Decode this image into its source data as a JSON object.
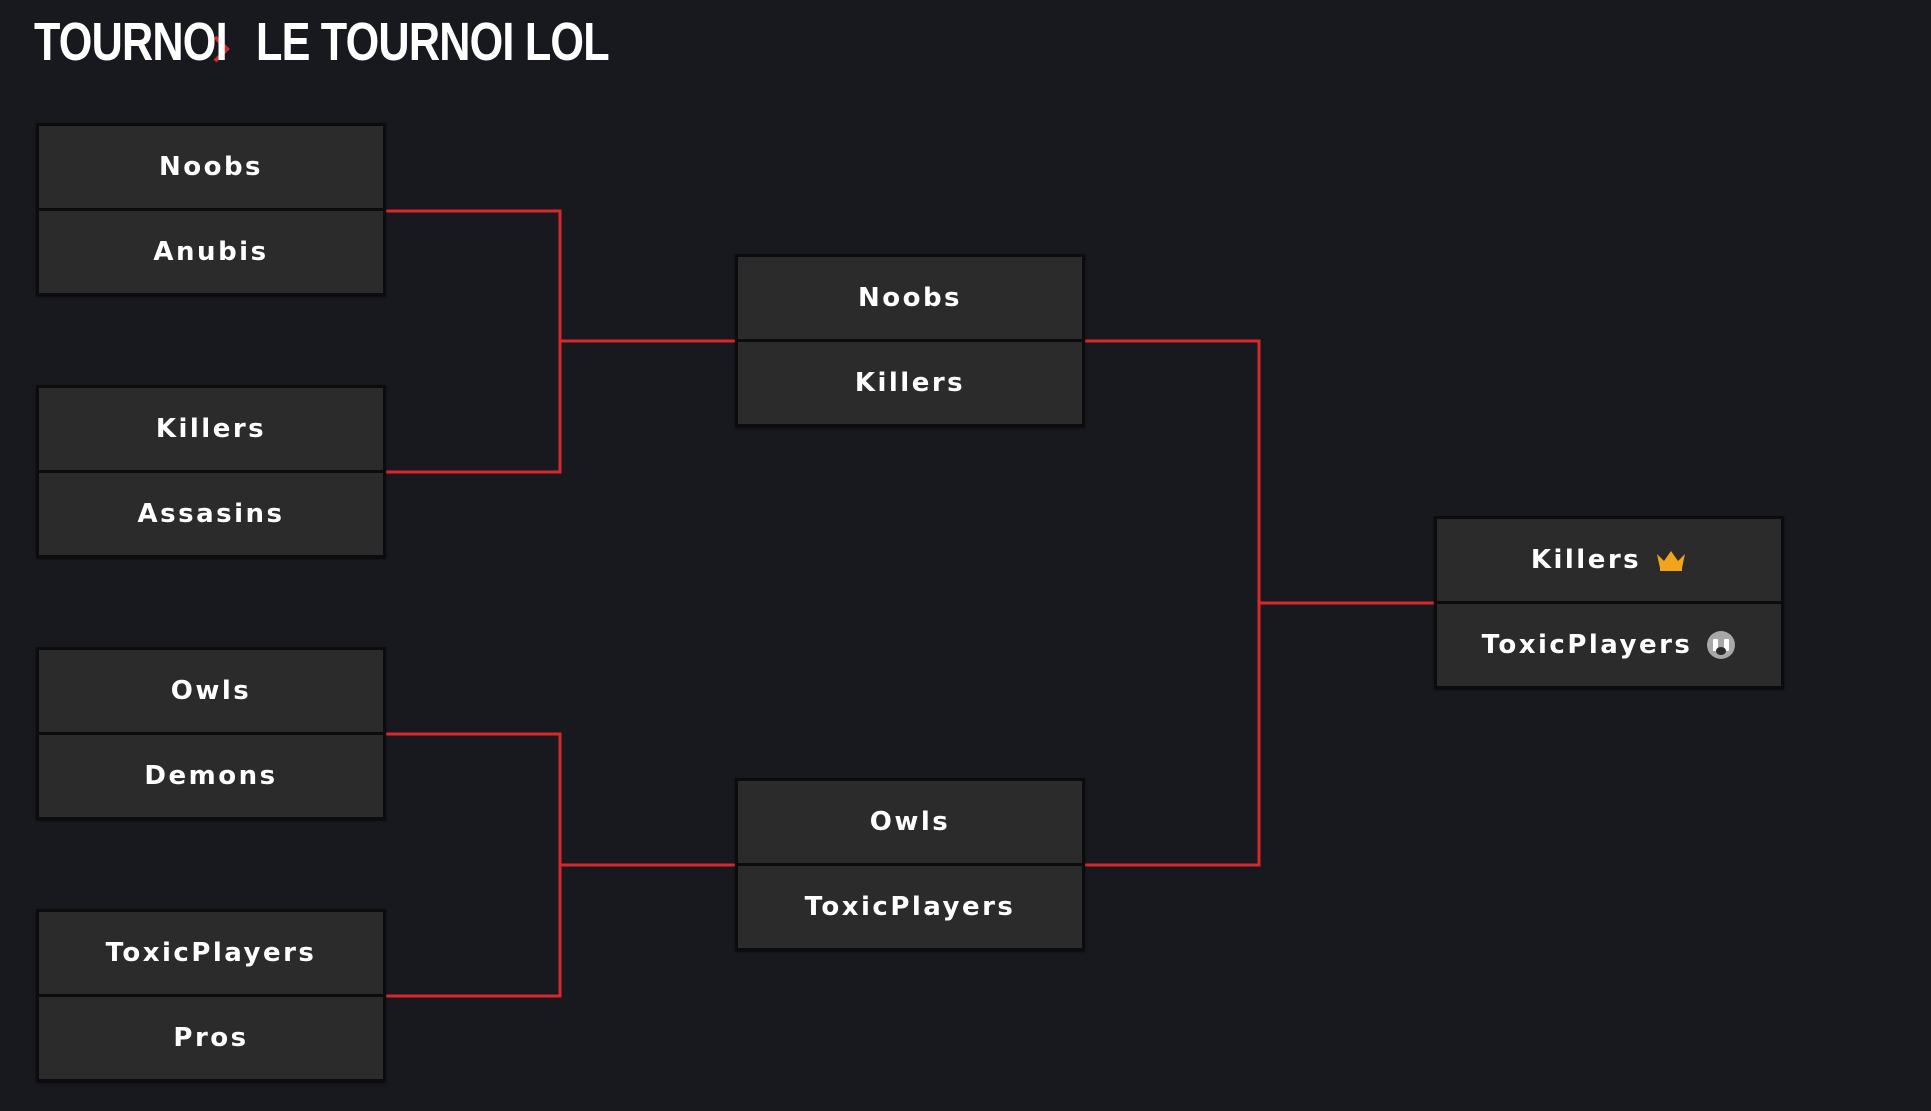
{
  "breadcrumb": {
    "root": "TOURNOI",
    "current": "LE TOURNOI LOL"
  },
  "colors": {
    "background": "#18191e",
    "card": "#2b2b2c",
    "accent_red": "#d8282d",
    "crown_gold": "#f2a51a",
    "loser_grey": "#a8a8a8"
  },
  "rounds": [
    {
      "matches": [
        {
          "team1": "Noobs",
          "team2": "Anubis"
        },
        {
          "team1": "Killers",
          "team2": "Assasins"
        },
        {
          "team1": "Owls",
          "team2": "Demons"
        },
        {
          "team1": "ToxicPlayers",
          "team2": "Pros"
        }
      ]
    },
    {
      "matches": [
        {
          "team1": "Noobs",
          "team2": "Killers"
        },
        {
          "team1": "Owls",
          "team2": "ToxicPlayers"
        }
      ]
    },
    {
      "matches": [
        {
          "team1": "Killers",
          "team1_icon": "crown-icon",
          "team2": "ToxicPlayers",
          "team2_icon": "crying-face-icon"
        }
      ]
    }
  ]
}
